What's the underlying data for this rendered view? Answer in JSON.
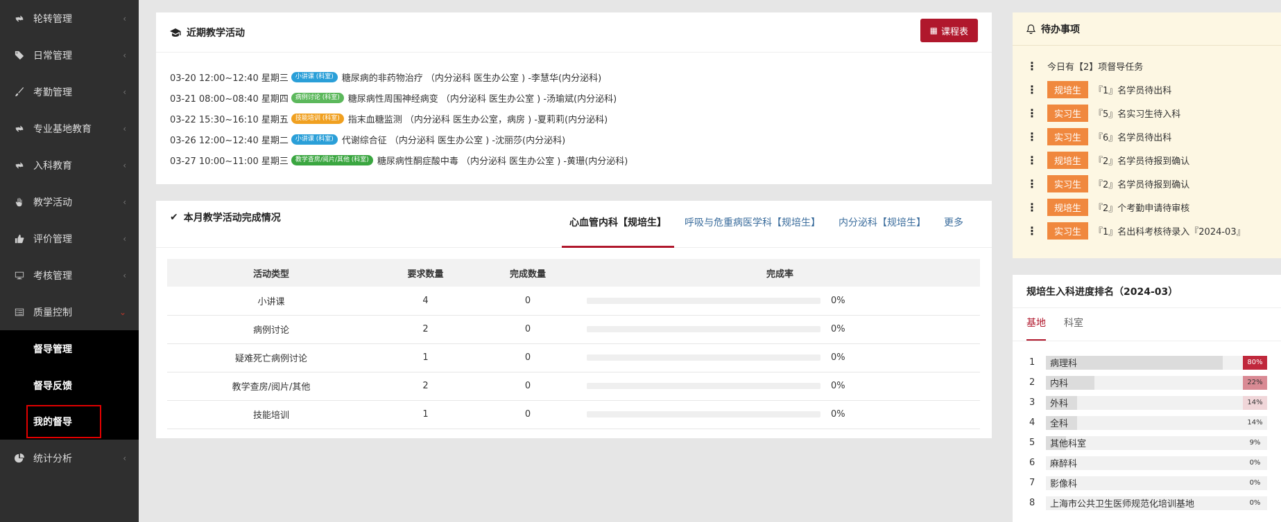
{
  "sidebar": {
    "items": [
      {
        "label": "轮转管理",
        "icon": "rotate-icon"
      },
      {
        "label": "日常管理",
        "icon": "tag-icon"
      },
      {
        "label": "考勤管理",
        "icon": "brush-icon"
      },
      {
        "label": "专业基地教育",
        "icon": "rotate-icon"
      },
      {
        "label": "入科教育",
        "icon": "rotate-icon"
      },
      {
        "label": "教学活动",
        "icon": "hand-icon"
      },
      {
        "label": "评价管理",
        "icon": "thumbs-up-icon"
      },
      {
        "label": "考核管理",
        "icon": "monitor-icon"
      },
      {
        "label": "质量控制",
        "icon": "list-icon"
      }
    ],
    "subitems": [
      "督导管理",
      "督导反馈",
      "我的督导"
    ],
    "last_item": {
      "label": "统计分析",
      "icon": "pie-chart-icon"
    }
  },
  "recent": {
    "title": "近期教学活动",
    "schedule_button": "课程表",
    "rows": [
      {
        "time": "03-20 12:00~12:40 星期三",
        "tag": "小讲课 (科室)",
        "tag_color": "#2a9fd8",
        "text": "糖尿病的非药物治疗 （内分泌科  医生办公室 ) -李慧华(内分泌科)"
      },
      {
        "time": "03-21 08:00~08:40 星期四",
        "tag": "病例讨论 (科室)",
        "tag_color": "#5cb85c",
        "text": "糖尿病性周围神经病变 （内分泌科  医生办公室 ) -汤瑜斌(内分泌科)"
      },
      {
        "time": "03-22 15:30~16:10 星期五",
        "tag": "技能培训 (科室)",
        "tag_color": "#f0a020",
        "text": "指末血糖监测 （内分泌科  医生办公室，病房 ) -夏莉莉(内分泌科)"
      },
      {
        "time": "03-26 12:00~12:40 星期二",
        "tag": "小讲课 (科室)",
        "tag_color": "#2a9fd8",
        "text": "代谢综合征 （内分泌科  医生办公室 ) -沈丽莎(内分泌科)"
      },
      {
        "time": "03-27 10:00~11:00 星期三",
        "tag": "教学查房/阅片/其他 (科室)",
        "tag_color": "#3aa640",
        "text": "糖尿病性酮症酸中毒 （内分泌科  医生办公室 ) -黄珊(内分泌科)"
      }
    ]
  },
  "completion": {
    "title": "本月教学活动完成情况",
    "tabs": [
      "心血管内科【规培生】",
      "呼吸与危重病医学科【规培生】",
      "内分泌科【规培生】",
      "更多"
    ],
    "columns": [
      "活动类型",
      "要求数量",
      "完成数量",
      "完成率"
    ],
    "rows": [
      {
        "type": "小讲课",
        "required": "4",
        "done": "0",
        "rate": "0%",
        "rate_value": 0
      },
      {
        "type": "病例讨论",
        "required": "2",
        "done": "0",
        "rate": "0%",
        "rate_value": 0
      },
      {
        "type": "疑难死亡病例讨论",
        "required": "1",
        "done": "0",
        "rate": "0%",
        "rate_value": 0
      },
      {
        "type": "教学查房/阅片/其他",
        "required": "2",
        "done": "0",
        "rate": "0%",
        "rate_value": 0
      },
      {
        "type": "技能培训",
        "required": "1",
        "done": "0",
        "rate": "0%",
        "rate_value": 0
      }
    ]
  },
  "todo": {
    "title": "待办事项",
    "items": [
      {
        "badge": "",
        "badge_color": "",
        "text": "今日有【2】项督导任务"
      },
      {
        "badge": "规培生",
        "badge_color": "#f0883e",
        "text": "『1』名学员待出科"
      },
      {
        "badge": "实习生",
        "badge_color": "#f0883e",
        "text": "『5』名实习生待入科"
      },
      {
        "badge": "实习生",
        "badge_color": "#f0883e",
        "text": "『6』名学员待出科"
      },
      {
        "badge": "规培生",
        "badge_color": "#f0883e",
        "text": "『2』名学员待报到确认"
      },
      {
        "badge": "实习生",
        "badge_color": "#f0883e",
        "text": "『2』名学员待报到确认"
      },
      {
        "badge": "规培生",
        "badge_color": "#f0883e",
        "text": "『2』个考勤申请待审核"
      },
      {
        "badge": "实习生",
        "badge_color": "#f0883e",
        "text": "『1』名出科考核待录入『2024-03』"
      }
    ]
  },
  "rank": {
    "title": "规培生入科进度排名（2024-03）",
    "tabs": [
      "基地",
      "科室"
    ],
    "items": [
      {
        "num": "1",
        "name": "病理科",
        "pct": "80%",
        "value": 0.8,
        "pct_bg": "#c0283c",
        "pct_color": "#ffffff"
      },
      {
        "num": "2",
        "name": "内科",
        "pct": "22%",
        "value": 0.22,
        "pct_bg": "#d98a94",
        "pct_color": "#333333"
      },
      {
        "num": "3",
        "name": "外科",
        "pct": "14%",
        "value": 0.14,
        "pct_bg": "#f0d6d9",
        "pct_color": "#333333"
      },
      {
        "num": "4",
        "name": "全科",
        "pct": "14%",
        "value": 0.14,
        "pct_bg": "",
        "pct_color": "#333333"
      },
      {
        "num": "5",
        "name": "其他科室",
        "pct": "9%",
        "value": 0.09,
        "pct_bg": "",
        "pct_color": "#333333"
      },
      {
        "num": "6",
        "name": "麻醉科",
        "pct": "0%",
        "value": 0,
        "pct_bg": "",
        "pct_color": "#333333"
      },
      {
        "num": "7",
        "name": "影像科",
        "pct": "0%",
        "value": 0,
        "pct_bg": "",
        "pct_color": "#333333"
      },
      {
        "num": "8",
        "name": "上海市公共卫生医师规范化培训基地",
        "pct": "0%",
        "value": 0,
        "pct_bg": "",
        "pct_color": "#333333"
      }
    ]
  },
  "colors": {
    "accent": "#b0172c",
    "badge": "#f0883e",
    "sidebar": "#2f2f2f"
  }
}
